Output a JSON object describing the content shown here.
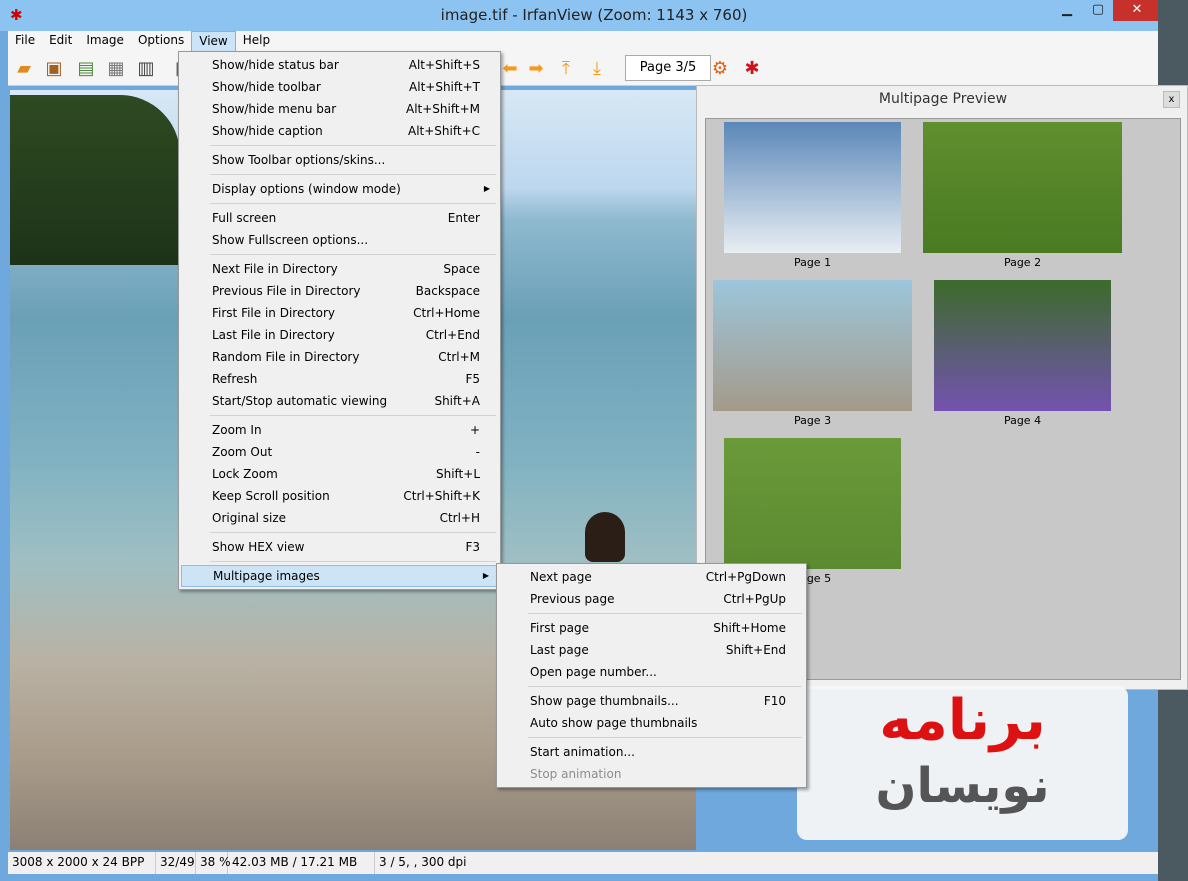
{
  "window": {
    "title": "image.tif - IrfanView (Zoom: 1143 x 760)",
    "minimize": "▁",
    "maximize": "▢",
    "close": "✕"
  },
  "menubar": [
    "File",
    "Edit",
    "Image",
    "Options",
    "View",
    "Help"
  ],
  "toolbar": {
    "page": "Page 3/5",
    "icons": [
      "open-folder-icon",
      "slideshow-icon",
      "thumbnails-icon",
      "save-icon",
      "print-icon",
      "delete-icon",
      "prev-icon",
      "next-icon",
      "first-page-icon",
      "last-page-icon",
      "settings-icon",
      "irfanview-logo-icon"
    ]
  },
  "view_menu": [
    {
      "label": "Show/hide status bar",
      "shortcut": "Alt+Shift+S"
    },
    {
      "label": "Show/hide toolbar",
      "shortcut": "Alt+Shift+T"
    },
    {
      "label": "Show/hide menu bar",
      "shortcut": "Alt+Shift+M"
    },
    {
      "label": "Show/hide caption",
      "shortcut": "Alt+Shift+C"
    },
    {
      "sep": true
    },
    {
      "label": "Show Toolbar options/skins...",
      "shortcut": ""
    },
    {
      "sep": true
    },
    {
      "label": "Display options (window mode)",
      "shortcut": "",
      "submenu": true
    },
    {
      "sep": true
    },
    {
      "label": "Full screen",
      "shortcut": "Enter"
    },
    {
      "label": "Show Fullscreen options...",
      "shortcut": ""
    },
    {
      "sep": true
    },
    {
      "label": "Next File in Directory",
      "shortcut": "Space"
    },
    {
      "label": "Previous File in Directory",
      "shortcut": "Backspace"
    },
    {
      "label": "First File in Directory",
      "shortcut": "Ctrl+Home"
    },
    {
      "label": "Last File in Directory",
      "shortcut": "Ctrl+End"
    },
    {
      "label": "Random File in Directory",
      "shortcut": "Ctrl+M"
    },
    {
      "label": "Refresh",
      "shortcut": "F5"
    },
    {
      "label": "Start/Stop automatic viewing",
      "shortcut": "Shift+A"
    },
    {
      "sep": true
    },
    {
      "label": "Zoom In",
      "shortcut": "+"
    },
    {
      "label": "Zoom Out",
      "shortcut": "-"
    },
    {
      "label": "Lock Zoom",
      "shortcut": "Shift+L"
    },
    {
      "label": "Keep Scroll position",
      "shortcut": "Ctrl+Shift+K"
    },
    {
      "label": "Original size",
      "shortcut": "Ctrl+H"
    },
    {
      "sep": true
    },
    {
      "label": "Show HEX view",
      "shortcut": "F3"
    },
    {
      "sep": true
    },
    {
      "label": "Multipage images",
      "shortcut": "",
      "submenu": true,
      "highlighted": true
    }
  ],
  "multipage_menu": [
    {
      "label": "Next page",
      "shortcut": "Ctrl+PgDown"
    },
    {
      "label": "Previous page",
      "shortcut": "Ctrl+PgUp"
    },
    {
      "sep": true
    },
    {
      "label": "First page",
      "shortcut": "Shift+Home"
    },
    {
      "label": "Last page",
      "shortcut": "Shift+End"
    },
    {
      "label": "Open page number...",
      "shortcut": ""
    },
    {
      "sep": true
    },
    {
      "label": "Show page thumbnails...",
      "shortcut": "F10"
    },
    {
      "label": "Auto show page thumbnails",
      "shortcut": ""
    },
    {
      "sep": true
    },
    {
      "label": "Start animation...",
      "shortcut": ""
    },
    {
      "label": "Stop animation",
      "shortcut": "",
      "disabled": true
    }
  ],
  "preview": {
    "title": "Multipage Preview",
    "close": "x",
    "pages": [
      {
        "label": "Page 1",
        "colors": [
          "#5b87b8",
          "#e8eef3"
        ]
      },
      {
        "label": "Page 2",
        "colors": [
          "#5f8f2e",
          "#4a7a22"
        ]
      },
      {
        "label": "Page 3",
        "colors": [
          "#9cc6db",
          "#a59a8a"
        ]
      },
      {
        "label": "Page 4",
        "colors": [
          "#3c6b2a",
          "#7452b0"
        ]
      },
      {
        "label": "Page 5",
        "colors": [
          "#6a9a3a",
          "#5b8a30"
        ]
      }
    ]
  },
  "watermark": {
    "line1": "برنامه",
    "line2": "نویسان"
  },
  "statusbar": [
    "3008 x 2000 x 24 BPP",
    "32/49",
    "38 %",
    "42.03 MB / 17.21 MB",
    "3 / 5, , 300 dpi"
  ]
}
